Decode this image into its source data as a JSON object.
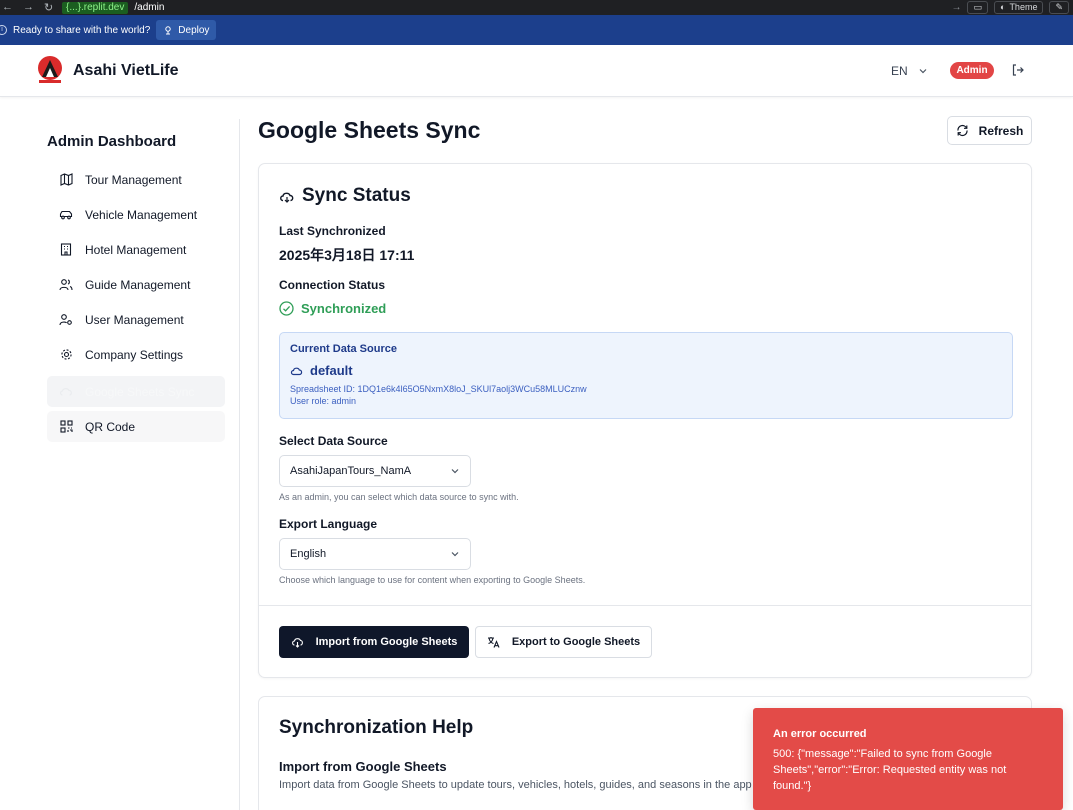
{
  "browser": {
    "url_host": "{...}.replit.dev",
    "url_path": "/admin",
    "theme_label": "Theme"
  },
  "banner": {
    "message": "Ready to share with the world?",
    "deploy_label": "Deploy"
  },
  "header": {
    "brand": "Asahi VietLife",
    "language": "EN",
    "role_badge": "Admin"
  },
  "sidebar": {
    "title": "Admin Dashboard",
    "items": [
      {
        "label": "Tour Management",
        "icon": "map-icon"
      },
      {
        "label": "Vehicle Management",
        "icon": "car-icon"
      },
      {
        "label": "Hotel Management",
        "icon": "building-icon"
      },
      {
        "label": "Guide Management",
        "icon": "users-icon"
      },
      {
        "label": "User Management",
        "icon": "user-cog-icon"
      },
      {
        "label": "Company Settings",
        "icon": "gear-icon"
      },
      {
        "label": "Google Sheets Sync",
        "icon": "cloud-sync-icon",
        "active": true
      },
      {
        "label": "QR Code",
        "icon": "qr-code-icon"
      }
    ]
  },
  "main": {
    "title": "Google Sheets Sync",
    "refresh_label": "Refresh"
  },
  "sync": {
    "title": "Sync Status",
    "last_sync_label": "Last Synchronized",
    "last_sync_value": "2025年3月18日 17:11",
    "connection_label": "Connection Status",
    "connection_value": "Synchronized",
    "source_box": {
      "title": "Current Data Source",
      "name": "default",
      "spreadsheet_id": "Spreadsheet ID: 1DQ1e6k4l65O5NxmX8loJ_SKUl7aolj3WCu58MLUCznw",
      "role": "User role: admin"
    },
    "select_source_label": "Select Data Source",
    "select_source_value": "AsahiJapanTours_NamA",
    "select_source_hint": "As an admin, you can select which data source to sync with.",
    "export_lang_label": "Export Language",
    "export_lang_value": "English",
    "export_lang_hint": "Choose which language to use for content when exporting to Google Sheets.",
    "import_label": "Import from Google Sheets",
    "export_label": "Export to Google Sheets"
  },
  "help": {
    "title": "Synchronization Help",
    "import_title": "Import from Google Sheets",
    "import_desc": "Import data from Google Sheets to update tours, vehicles, hotels, guides, and seasons in the app"
  },
  "toast": {
    "title": "An error occurred",
    "message": "500: {\"message\":\"Failed to sync from Google Sheets\",\"error\":\"Error: Requested entity was not found.\"}"
  },
  "colors": {
    "banner": "#1c3f8c",
    "accent_red": "#e24545",
    "success": "#2f9e57",
    "primary_button": "#0f172a",
    "toast": "#e34b48"
  }
}
